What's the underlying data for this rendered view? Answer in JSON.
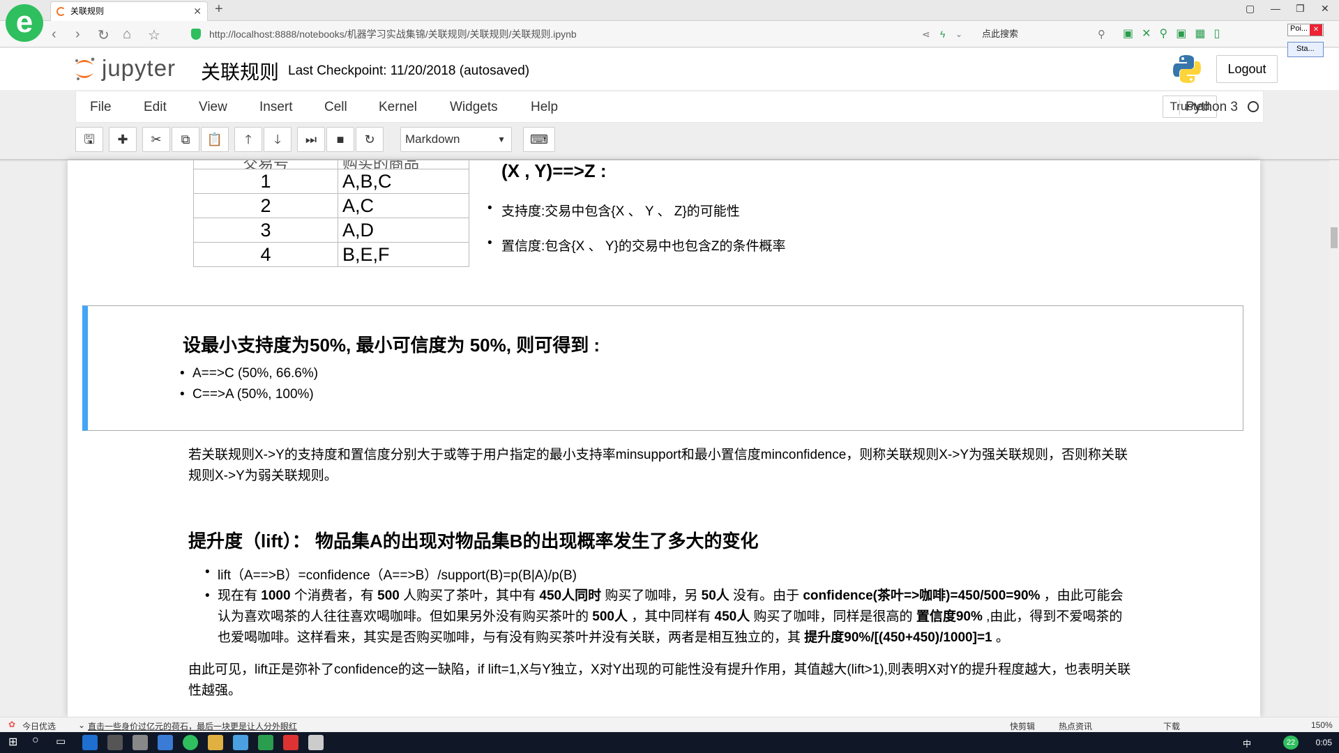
{
  "browser": {
    "tab_title": "关联规则",
    "url": "http://localhost:8888/notebooks/机器学习实战集锦/关联规则/关联规则/关联规则.ipynb",
    "search_placeholder": "点此搜索",
    "popup_text": "Poi...",
    "popup2_text": "Sta..."
  },
  "jupyter": {
    "logo_text": "jupyter",
    "notebook_title": "关联规则",
    "checkpoint": "Last Checkpoint: 11/20/2018 (autosaved)",
    "logout_label": "Logout",
    "trusted_label": "Trusted",
    "kernel_name": "Python 3",
    "menu": [
      "File",
      "Edit",
      "View",
      "Insert",
      "Cell",
      "Kernel",
      "Widgets",
      "Help"
    ],
    "cell_type": "Markdown"
  },
  "table": {
    "header": [
      "交易号",
      "购买的商品"
    ],
    "rows": [
      [
        "1",
        "A,B,C"
      ],
      [
        "2",
        "A,C"
      ],
      [
        "3",
        "A,D"
      ],
      [
        "4",
        "B,E,F"
      ]
    ]
  },
  "rule": {
    "title": "(X , Y)==>Z :",
    "support": "支持度:交易中包含{X 、 Y 、 Z}的可能性",
    "confidence": "置信度:包含{X 、 Y}的交易中也包含Z的条件概率"
  },
  "selected_cell": {
    "heading": "设最小支持度为50%, 最小可信度为 50%, 则可得到 :",
    "items": [
      "A==>C (50%, 66.6%)",
      "C==>A (50%, 100%)"
    ]
  },
  "strong_rule": {
    "line1": "若关联规则X->Y的支持度和置信度分别大于或等于用户指定的最小支持率minsupport和最小置信度minconfidence，则称关联规则X->Y为强关联规则，否则称关联",
    "line2": "规则X->Y为弱关联规则。"
  },
  "lift": {
    "heading": "提升度（lift）： 物品集A的出现对物品集B的出现概率发生了多大的变化",
    "formula": "lift（A==>B）=confidence（A==>B）/support(B)=p(B|A)/p(B)",
    "ex_a1": "现在有 ",
    "ex_b1": "1000",
    "ex_a2": " 个消费者，有 ",
    "ex_b2": "500",
    "ex_a3": " 人购买了茶叶，其中有 ",
    "ex_b3": "450人同时",
    "ex_a4": " 购买了咖啡，另 ",
    "ex_b4": "50人",
    "ex_a5": " 没有。由于 ",
    "ex_b5": "confidence(茶叶=>咖啡)=450/500=90%",
    "ex_a6": " ，由此可能会",
    "ex_line2_a": "认为喜欢喝茶的人往往喜欢喝咖啡。但如果另外没有购买茶叶的 ",
    "ex_line2_b": "500人",
    "ex_line2_c": " ，其中同样有 ",
    "ex_line2_d": "450人",
    "ex_line2_e": " 购买了咖啡，同样是很高的 ",
    "ex_line2_f": "置信度90%",
    "ex_line2_g": " ,由此，得到不爱喝茶的",
    "ex_line3_a": "也爱喝咖啡。这样看来，其实是否购买咖啡，与有没有购买茶叶并没有关联，两者是相互独立的，其 ",
    "ex_line3_b": "提升度90%/[(450+450)/1000]=1",
    "ex_line3_c": " 。",
    "conclusion1": "由此可见，lift正是弥补了confidence的这一缺陷，if lift=1,X与Y独立，X对Y出现的可能性没有提升作用，其值越大(lift>1),则表明X对Y的提升程度越大，也表明关联",
    "conclusion2": "性越强。"
  },
  "status": {
    "left1": "今日优选",
    "left2": "直击一些身价过亿元的荷石，最后一块更是让人分外眼红",
    "right1": "快剪辑",
    "right2": "热点资讯",
    "right3": "下载",
    "zoom": "150%"
  },
  "taskbar": {
    "clock": "0:05",
    "badge": "22",
    "ime": "中"
  }
}
